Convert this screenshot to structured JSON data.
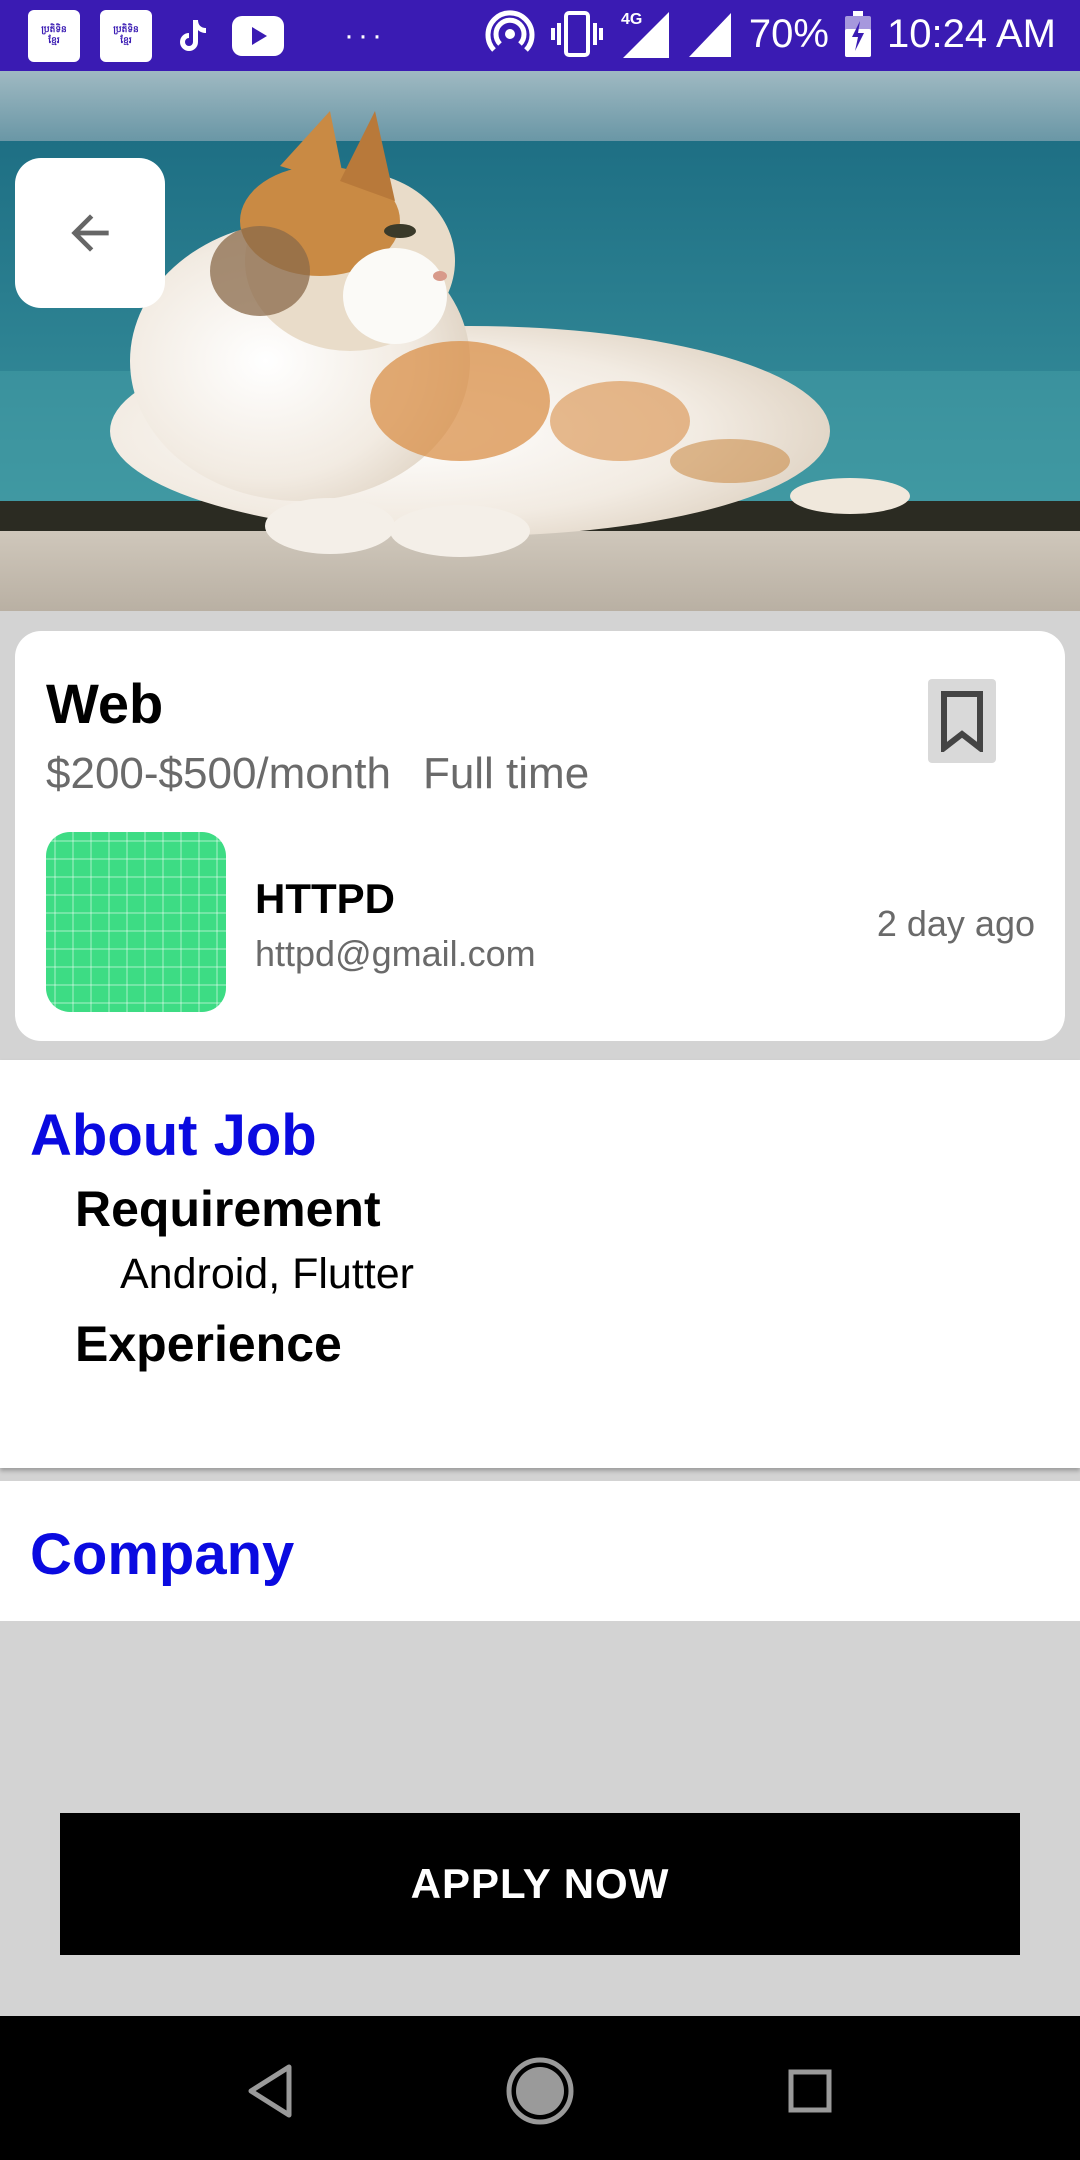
{
  "status_bar": {
    "app_icon_lines": [
      "ប្រតិទិន",
      "ខ្មែរ"
    ],
    "battery": "70%",
    "time": "10:24 AM",
    "network": "4G",
    "icons": [
      "calendar-app-icon",
      "calendar-app-icon",
      "tiktok-icon",
      "youtube-icon",
      "more-dots-icon",
      "hotspot-icon",
      "vibrate-icon",
      "signal-4g-icon",
      "signal-icon",
      "battery-charging-icon"
    ]
  },
  "header": {
    "back_icon": "arrow-back-icon"
  },
  "job": {
    "title": "Web",
    "salary": "$200-$500/month",
    "type": "Full time",
    "bookmark_icon": "bookmark-icon",
    "company_name": "HTTPD",
    "company_email": "httpd@gmail.com",
    "posted": "2 day ago",
    "logo_color": "#3ddc84"
  },
  "about": {
    "title": "About Job",
    "requirement_heading": "Requirement",
    "requirement_value": "Android, Flutter",
    "experience_heading": "Experience"
  },
  "company_section": {
    "title": "Company"
  },
  "apply_label": "APPLY NOW",
  "colors": {
    "status_bar": "#3a1bb3",
    "section_title": "#0a0ae0",
    "background": "#d3d3d3"
  }
}
